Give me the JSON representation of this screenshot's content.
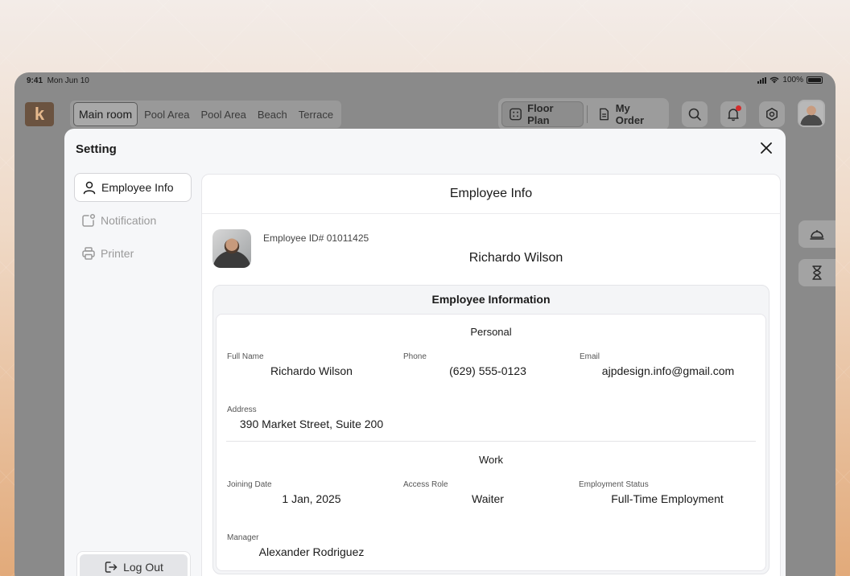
{
  "status_bar": {
    "time": "9:41",
    "date": "Mon Jun 10",
    "battery": "100%"
  },
  "header": {
    "logo": "k",
    "room_tabs": [
      "Main room",
      "Pool Area",
      "Pool Area",
      "Beach",
      "Terrace"
    ],
    "active_room": "Main room",
    "views": [
      {
        "label": "Floor Plan",
        "icon": "floor-plan-icon",
        "active": true
      },
      {
        "label": "My Order",
        "icon": "document-icon",
        "active": false
      }
    ]
  },
  "modal": {
    "title": "Setting",
    "nav": [
      {
        "label": "Employee Info",
        "icon": "user-icon",
        "active": true
      },
      {
        "label": "Notification",
        "icon": "notification-icon",
        "active": false
      },
      {
        "label": "Printer",
        "icon": "printer-icon",
        "active": false
      }
    ],
    "logout_label": "Log Out"
  },
  "employee": {
    "panel_title": "Employee Info",
    "id_line": "Employee ID# 01011425",
    "name": "Richardo Wilson",
    "info_title": "Employee Information",
    "personal": {
      "title": "Personal",
      "full_name_label": "Full Name",
      "full_name": "Richardo Wilson",
      "phone_label": "Phone",
      "phone": "(629) 555-0123",
      "email_label": "Email",
      "email": "ajpdesign.info@gmail.com",
      "address_label": "Address",
      "address": "390 Market Street, Suite 200"
    },
    "work": {
      "title": "Work",
      "joining_label": "Joining Date",
      "joining": "1 Jan, 2025",
      "role_label": "Access Role",
      "role": "Waiter",
      "status_label": "Employment Status",
      "status": "Full-Time Employment",
      "manager_label": "Manager",
      "manager": "Alexander Rodriguez"
    }
  },
  "colors": {
    "accent": "#1a1a1a",
    "notification_dot": "#d42c2c"
  }
}
